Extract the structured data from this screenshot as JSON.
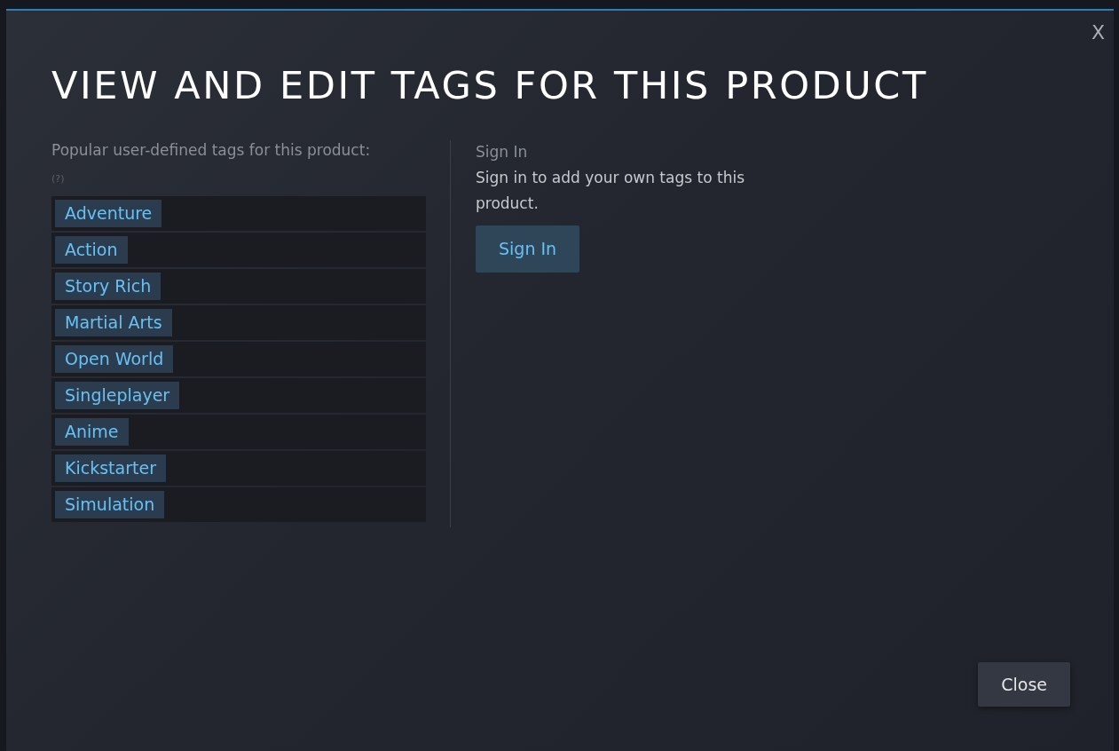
{
  "dialog": {
    "close_glyph": "X",
    "title": "VIEW AND EDIT TAGS FOR THIS PRODUCT"
  },
  "tags_panel": {
    "intro": "Popular user-defined tags for this product:",
    "help": "(?)",
    "tags": [
      "Adventure",
      "Action",
      "Story Rich",
      "Martial Arts",
      "Open World",
      "Singleplayer",
      "Anime",
      "Kickstarter",
      "Simulation"
    ]
  },
  "sign_in_panel": {
    "heading": "Sign In",
    "text": "Sign in to add your own tags to this product.",
    "button": "Sign In"
  },
  "footer": {
    "button": "Close"
  }
}
